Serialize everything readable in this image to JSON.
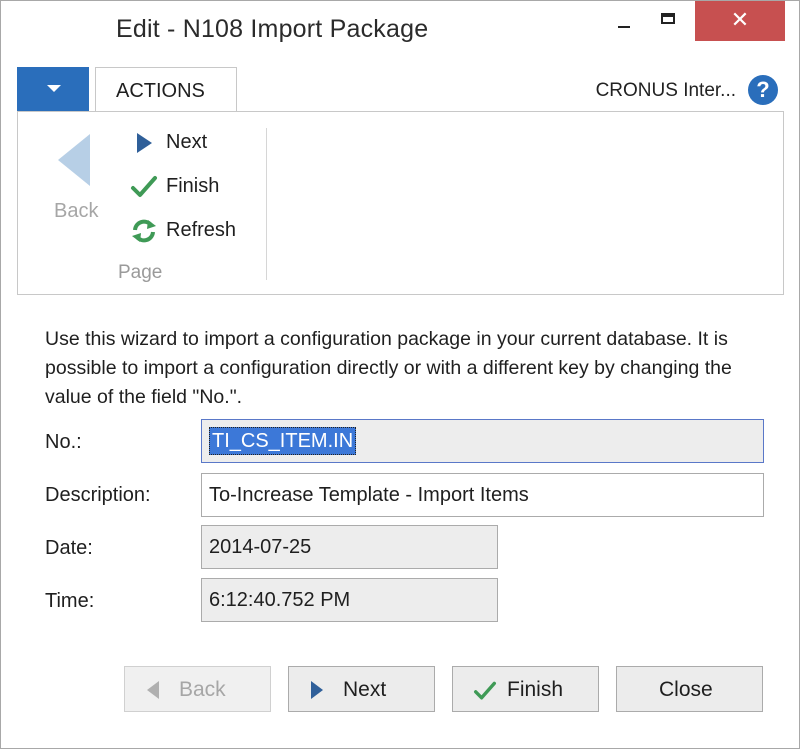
{
  "window": {
    "title": "Edit - N108 Import Package",
    "close_glyph": "✕"
  },
  "ribbon": {
    "tab_actions": "ACTIONS",
    "company": "CRONUS Inter...",
    "help_glyph": "?",
    "back_label": "Back",
    "next_label": "Next",
    "finish_label": "Finish",
    "refresh_label": "Refresh",
    "group_label": "Page"
  },
  "content": {
    "description": "Use this wizard to import a configuration package in your current database. It is possible to import a configuration directly or with a different key by changing the value of the field \"No.\".",
    "fields": {
      "no_label": "No.:",
      "no_value": "TI_CS_ITEM.IN",
      "description_label": "Description:",
      "description_value": "To-Increase Template - Import Items",
      "date_label": "Date:",
      "date_value": "2014-07-25",
      "time_label": "Time:",
      "time_value": "6:12:40.752 PM"
    }
  },
  "buttons": {
    "back": "Back",
    "next": "Next",
    "finish": "Finish",
    "close": "Close"
  },
  "colors": {
    "accent": "#2a6ebb",
    "close_red": "#c75050",
    "nav_arrow": "#2f5f99",
    "check_green": "#3f9a56",
    "selection": "#3c78d8"
  },
  "icons": {
    "back": "back-arrow-icon",
    "next": "next-arrow-icon",
    "finish": "checkmark-icon",
    "refresh": "refresh-icon",
    "help": "help-icon"
  }
}
